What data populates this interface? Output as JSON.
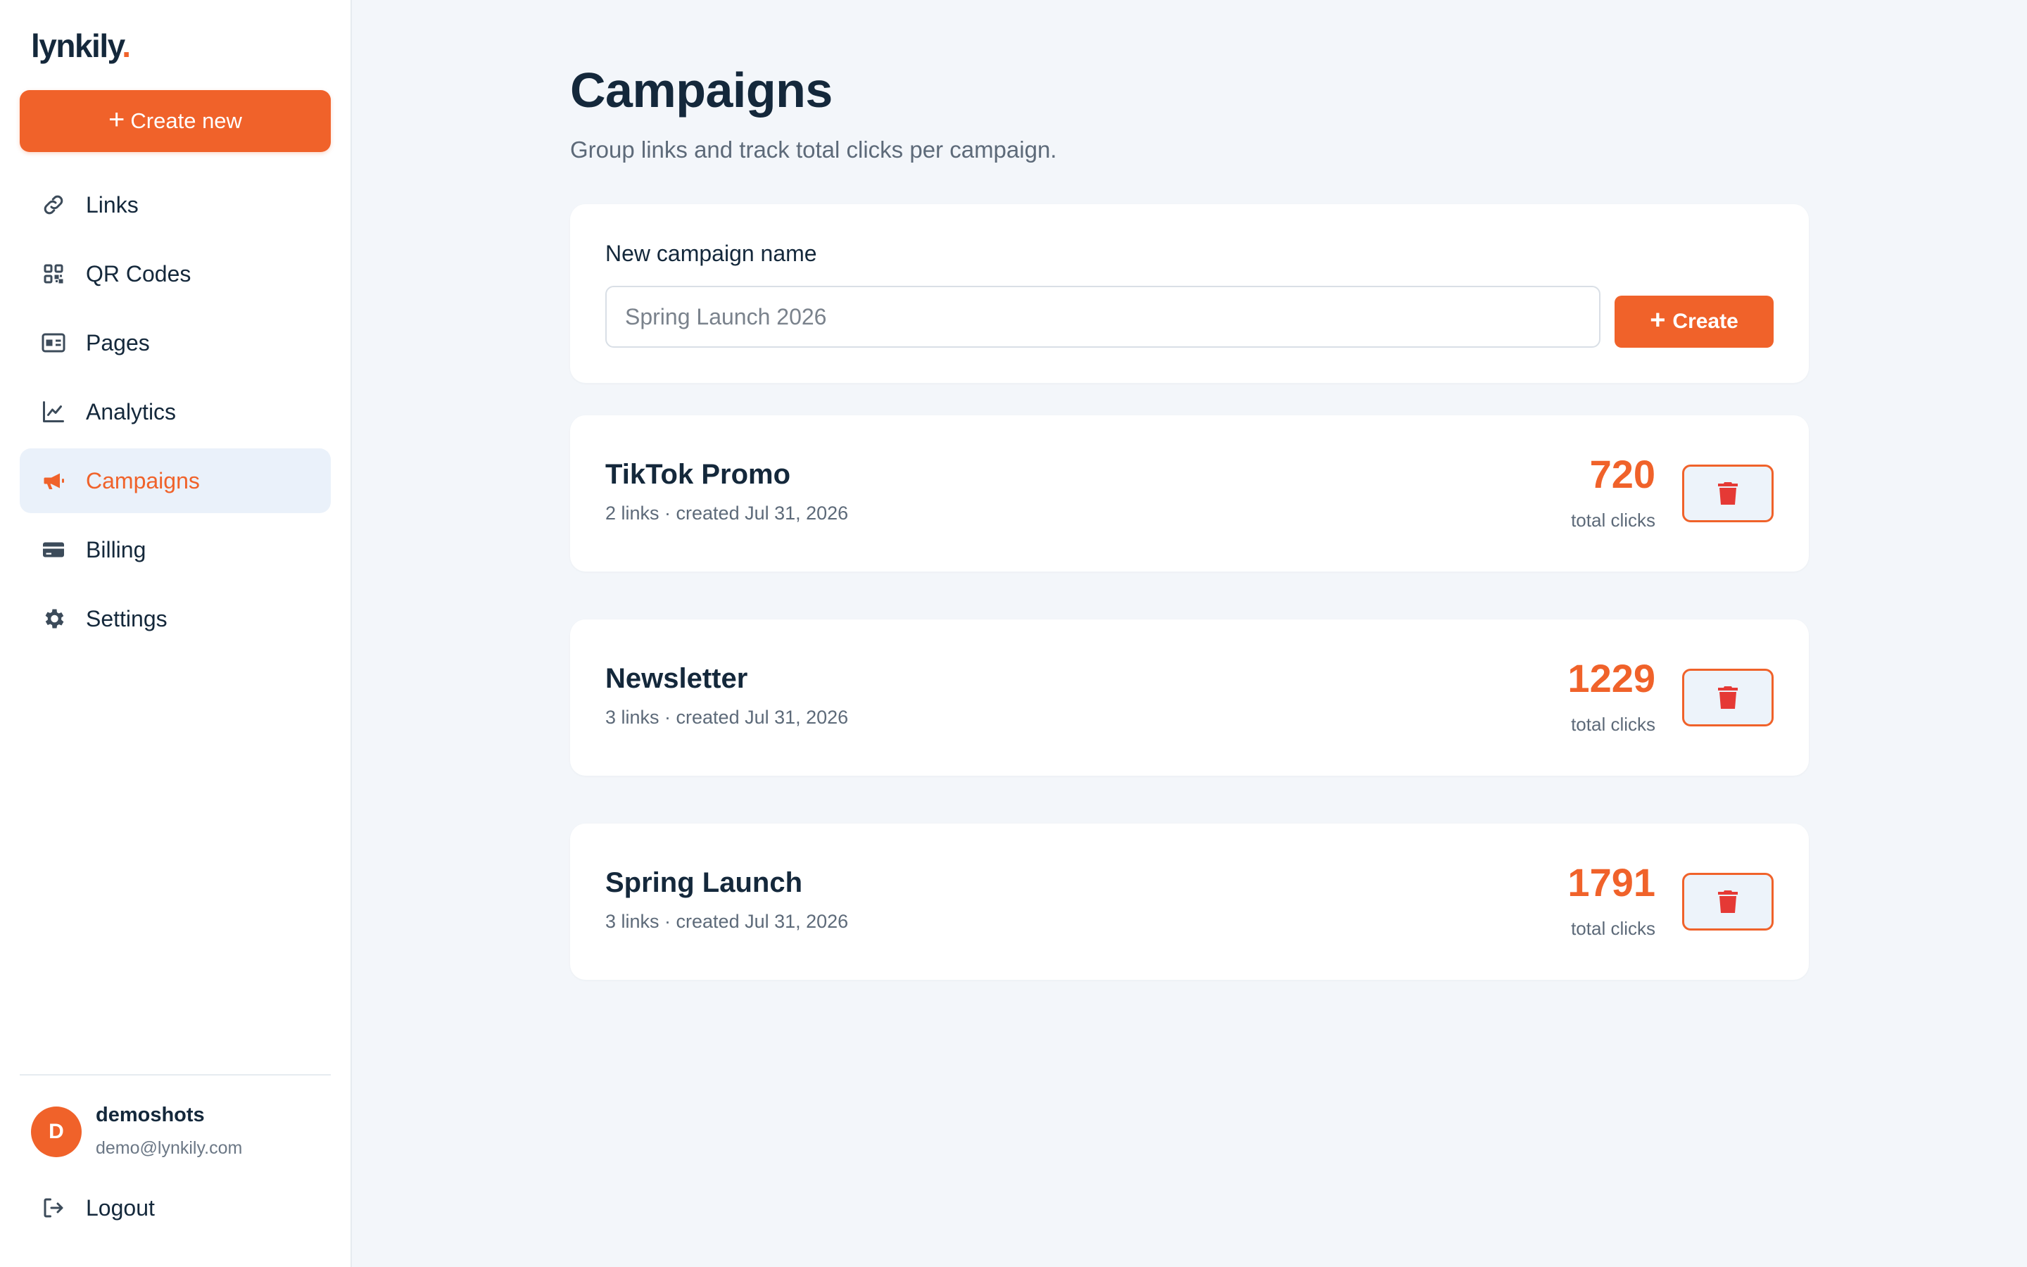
{
  "brand": {
    "name": "lynkily",
    "dot": "."
  },
  "sidebar": {
    "create_label": "Create new",
    "items": [
      {
        "label": "Links",
        "icon": "link-icon",
        "active": false
      },
      {
        "label": "QR Codes",
        "icon": "qr-code-icon",
        "active": false
      },
      {
        "label": "Pages",
        "icon": "id-card-icon",
        "active": false
      },
      {
        "label": "Analytics",
        "icon": "line-chart-icon",
        "active": false
      },
      {
        "label": "Campaigns",
        "icon": "megaphone-icon",
        "active": true
      },
      {
        "label": "Billing",
        "icon": "credit-card-icon",
        "active": false
      },
      {
        "label": "Settings",
        "icon": "gear-icon",
        "active": false
      }
    ],
    "user": {
      "initial": "D",
      "name": "demoshots",
      "email": "demo@lynkily.com"
    },
    "logout_label": "Logout"
  },
  "main": {
    "title": "Campaigns",
    "subtitle": "Group links and track total clicks per campaign.",
    "new_campaign": {
      "label": "New campaign name",
      "placeholder": "Spring Launch 2026",
      "value": "",
      "create_label": "Create"
    },
    "campaigns": [
      {
        "name": "TikTok Promo",
        "meta": "2 links · created Jul 31, 2026",
        "clicks": "720",
        "clicks_label": "total clicks"
      },
      {
        "name": "Newsletter",
        "meta": "3 links · created Jul 31, 2026",
        "clicks": "1229",
        "clicks_label": "total clicks"
      },
      {
        "name": "Spring Launch",
        "meta": "3 links · created Jul 31, 2026",
        "clicks": "1791",
        "clicks_label": "total clicks"
      }
    ]
  },
  "colors": {
    "accent": "#f0622a",
    "text": "#14283b",
    "muted": "#5d6a79",
    "background": "#f3f6fa",
    "active_nav_bg": "#eaf1fa",
    "danger_icon": "#e53935"
  }
}
